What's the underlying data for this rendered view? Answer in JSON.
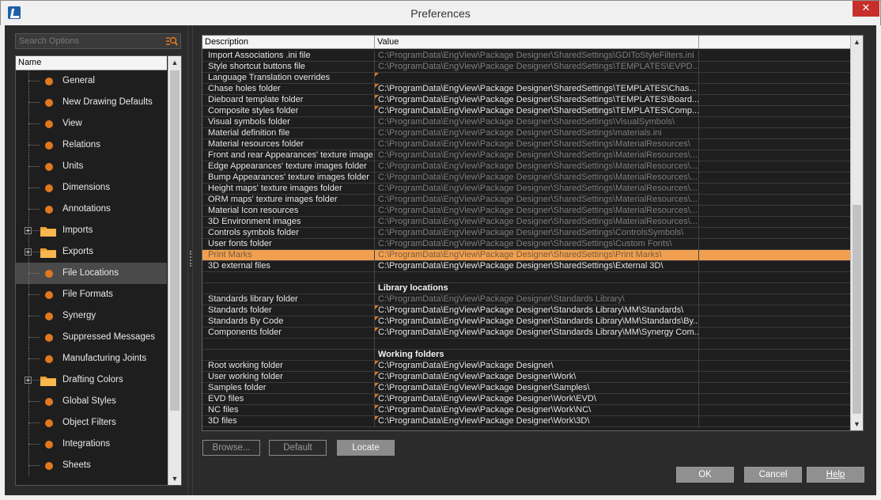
{
  "window": {
    "title": "Preferences",
    "close_glyph": "✕"
  },
  "search": {
    "placeholder": "Search Options"
  },
  "tree": {
    "header": "Name",
    "items": [
      {
        "label": "General",
        "kind": "leaf"
      },
      {
        "label": "New Drawing Defaults",
        "kind": "leaf"
      },
      {
        "label": "View",
        "kind": "leaf"
      },
      {
        "label": "Relations",
        "kind": "leaf"
      },
      {
        "label": "Units",
        "kind": "leaf"
      },
      {
        "label": "Dimensions",
        "kind": "leaf"
      },
      {
        "label": "Annotations",
        "kind": "leaf"
      },
      {
        "label": "Imports",
        "kind": "folder"
      },
      {
        "label": "Exports",
        "kind": "folder"
      },
      {
        "label": "File Locations",
        "kind": "leaf",
        "selected": true
      },
      {
        "label": "File Formats",
        "kind": "leaf"
      },
      {
        "label": "Synergy",
        "kind": "leaf"
      },
      {
        "label": "Suppressed Messages",
        "kind": "leaf"
      },
      {
        "label": "Manufacturing Joints",
        "kind": "leaf"
      },
      {
        "label": "Drafting Colors",
        "kind": "folder"
      },
      {
        "label": "Global Styles",
        "kind": "leaf"
      },
      {
        "label": "Object Filters",
        "kind": "leaf"
      },
      {
        "label": "Integrations",
        "kind": "leaf"
      },
      {
        "label": "Sheets",
        "kind": "leaf"
      }
    ]
  },
  "grid": {
    "columns": [
      "Description",
      "Value",
      ""
    ],
    "rows": [
      {
        "desc": "Import Associations .ini file",
        "value": "C:\\ProgramData\\EngView\\Package Designer\\SharedSettings\\GDIToStyleFilters.ini",
        "dim": true
      },
      {
        "desc": "Style shortcut buttons file",
        "value": "C:\\ProgramData\\EngView\\Package Designer\\SharedSettings\\TEMPLATES\\EVPD...",
        "dim": true
      },
      {
        "desc": "Language Translation overrides",
        "value": "",
        "marker": true
      },
      {
        "desc": "Chase holes folder",
        "value": "C:\\ProgramData\\EngView\\Package Designer\\SharedSettings\\TEMPLATES\\Chas...",
        "marker": true
      },
      {
        "desc": "Dieboard template folder",
        "value": "C:\\ProgramData\\EngView\\Package Designer\\SharedSettings\\TEMPLATES\\Board...",
        "marker": true
      },
      {
        "desc": "Composite styles folder",
        "value": "C:\\ProgramData\\EngView\\Package Designer\\SharedSettings\\TEMPLATES\\Comp...",
        "marker": true
      },
      {
        "desc": "Visual symbols folder",
        "value": "C:\\ProgramData\\EngView\\Package Designer\\SharedSettings\\VisualSymbols\\",
        "dim": true
      },
      {
        "desc": "Material definition file",
        "value": "C:\\ProgramData\\EngView\\Package Designer\\SharedSettings\\materials.ini",
        "dim": true
      },
      {
        "desc": "Material resources folder",
        "value": "C:\\ProgramData\\EngView\\Package Designer\\SharedSettings\\MaterialResources\\",
        "dim": true
      },
      {
        "desc": "Front and rear Appearances' texture image...",
        "value": "C:\\ProgramData\\EngView\\Package Designer\\SharedSettings\\MaterialResources\\...",
        "dim": true
      },
      {
        "desc": "Edge Appearances' texture images folder",
        "value": "C:\\ProgramData\\EngView\\Package Designer\\SharedSettings\\MaterialResources\\...",
        "dim": true
      },
      {
        "desc": "Bump Appearances' texture images folder",
        "value": "C:\\ProgramData\\EngView\\Package Designer\\SharedSettings\\MaterialResources\\...",
        "dim": true
      },
      {
        "desc": "Height maps' texture images folder",
        "value": "C:\\ProgramData\\EngView\\Package Designer\\SharedSettings\\MaterialResources\\...",
        "dim": true
      },
      {
        "desc": "ORM maps' texture images folder",
        "value": "C:\\ProgramData\\EngView\\Package Designer\\SharedSettings\\MaterialResources\\...",
        "dim": true
      },
      {
        "desc": "Material Icon resources",
        "value": "C:\\ProgramData\\EngView\\Package Designer\\SharedSettings\\MaterialResources\\...",
        "dim": true
      },
      {
        "desc": "3D Environment images",
        "value": "C:\\ProgramData\\EngView\\Package Designer\\SharedSettings\\MaterialResources\\...",
        "dim": true
      },
      {
        "desc": "Controls symbols folder",
        "value": "C:\\ProgramData\\EngView\\Package Designer\\SharedSettings\\ControlsSymbols\\",
        "dim": true
      },
      {
        "desc": "User fonts folder",
        "value": "C:\\ProgramData\\EngView\\Package Designer\\SharedSettings\\Custom Fonts\\",
        "dim": true
      },
      {
        "desc": "Print Marks",
        "value": "C:\\ProgramData\\EngView\\Package Designer\\SharedSettings\\Print Marks\\",
        "selected": true
      },
      {
        "desc": "3D external files",
        "value": "C:\\ProgramData\\EngView\\Package Designer\\SharedSettings\\External 3D\\"
      },
      {
        "desc": "",
        "value": ""
      },
      {
        "desc": "",
        "value": "Library locations",
        "section": true
      },
      {
        "desc": "Standards library folder",
        "value": "C:\\ProgramData\\EngView\\Package Designer\\Standards Library\\",
        "dim": true
      },
      {
        "desc": "Standards folder",
        "value": "C:\\ProgramData\\EngView\\Package Designer\\Standards Library\\MM\\Standards\\",
        "marker": true
      },
      {
        "desc": "Standards By Code",
        "value": "C:\\ProgramData\\EngView\\Package Designer\\Standards Library\\MM\\Standards\\By...",
        "marker": true
      },
      {
        "desc": "Components folder",
        "value": "C:\\ProgramData\\EngView\\Package Designer\\Standards Library\\MM\\Synergy Com...",
        "marker": true
      },
      {
        "desc": "",
        "value": ""
      },
      {
        "desc": "",
        "value": "Working folders",
        "section": true
      },
      {
        "desc": "Root working folder",
        "value": "C:\\ProgramData\\EngView\\Package Designer\\",
        "marker": true
      },
      {
        "desc": "User working folder",
        "value": "C:\\ProgramData\\EngView\\Package Designer\\Work\\",
        "marker": true
      },
      {
        "desc": "Samples folder",
        "value": "C:\\ProgramData\\EngView\\Package Designer\\Samples\\",
        "marker": true
      },
      {
        "desc": "EVD files",
        "value": "C:\\ProgramData\\EngView\\Package Designer\\Work\\EVD\\",
        "marker": true
      },
      {
        "desc": "NC files",
        "value": "C:\\ProgramData\\EngView\\Package Designer\\Work\\NC\\",
        "marker": true
      },
      {
        "desc": "3D files",
        "value": "C:\\ProgramData\\EngView\\Package Designer\\Work\\3D\\",
        "marker": true
      }
    ]
  },
  "actions": {
    "browse": "Browse...",
    "default": "Default",
    "locate": "Locate"
  },
  "dialog": {
    "ok": "OK",
    "cancel": "Cancel",
    "help": "Help"
  },
  "icons": {
    "app": "app-logo-icon",
    "search": "search-options-icon",
    "folder": "folder-icon",
    "close": "close-icon"
  },
  "colors": {
    "accent": "#e07820",
    "selection": "#f0a050",
    "close": "#c7302a"
  }
}
